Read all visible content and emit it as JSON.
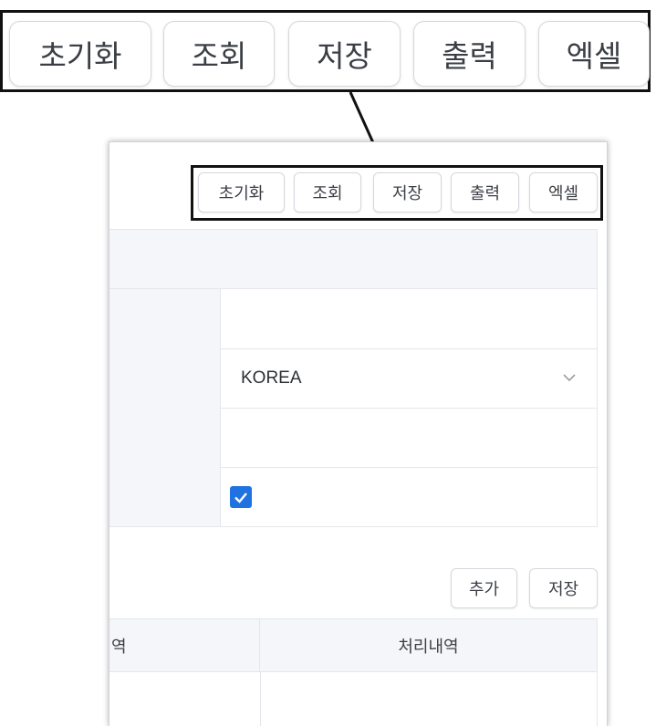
{
  "toolbar": {
    "reset_label": "초기화",
    "search_label": "조회",
    "save_label": "저장",
    "print_label": "출력",
    "excel_label": "엑셀"
  },
  "form": {
    "country_value": "KOREA",
    "checkbox_checked": true
  },
  "grid_toolbar": {
    "add_label": "추가",
    "save_label": "저장"
  },
  "grid": {
    "columns": [
      "역",
      "처리내역"
    ]
  },
  "colors": {
    "accent": "#1f72e0",
    "header_bg": "#f4f6f9"
  },
  "icons": [
    "chevron-down-icon",
    "checkmark-icon"
  ]
}
